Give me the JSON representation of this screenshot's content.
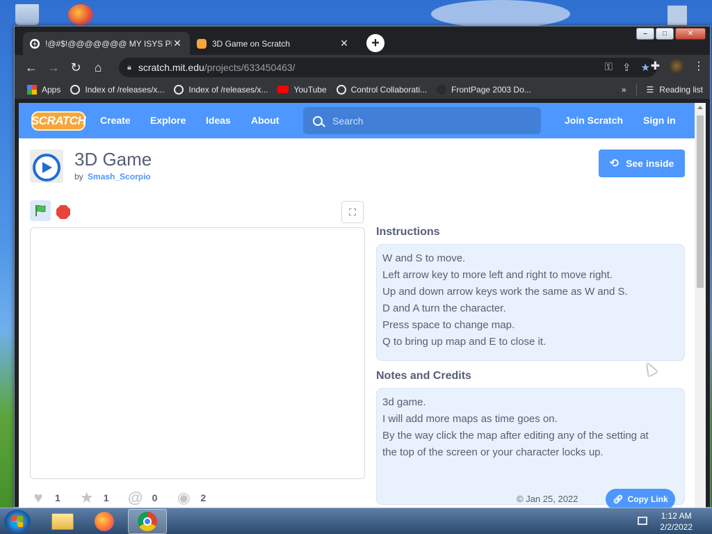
{
  "browser": {
    "tabs": [
      {
        "title": "!@#$!@@@@@@@ MY ISYS PF",
        "active": true
      },
      {
        "title": "3D Game on Scratch",
        "active": false
      }
    ],
    "url_host": "scratch.mit.edu",
    "url_path": "/projects/633450463/",
    "bookmarks": [
      {
        "label": "Apps"
      },
      {
        "label": "Index of /releases/x..."
      },
      {
        "label": "Index of /releases/x..."
      },
      {
        "label": "YouTube"
      },
      {
        "label": "Control Collaborati..."
      },
      {
        "label": "FrontPage 2003 Do..."
      }
    ],
    "more_bookmarks": "»",
    "reading_list": "Reading list"
  },
  "scratch_nav": {
    "logo": "SCRATCH",
    "links": [
      "Create",
      "Explore",
      "Ideas",
      "About"
    ],
    "search_placeholder": "Search",
    "join": "Join Scratch",
    "sign_in": "Sign in"
  },
  "project": {
    "title": "3D Game",
    "by_label": "by",
    "author": "Smash_Scorpio",
    "see_inside": "See inside",
    "instructions_title": "Instructions",
    "instructions": [
      "W and S to move.",
      "Left arrow key to more left and right to move right.",
      "Up and down arrow keys work the same as W and S.",
      "D and A turn the character.",
      "Press space to change map.",
      "Q to bring up map and E to close it."
    ],
    "notes_title": "Notes and Credits",
    "notes": [
      "3d game.",
      "I will add more maps as time goes on.",
      "By the way click the map after editing any of the setting at",
      "the top of the screen or your character locks up."
    ],
    "stats": {
      "loves": "1",
      "favorites": "1",
      "remixes": "0",
      "views": "2"
    },
    "date": "Jan 25, 2022",
    "copy_link": "Copy Link"
  },
  "taskbar": {
    "time": "1:12 AM",
    "date": "2/2/2022"
  },
  "colors": {
    "scratch_blue": "#4d97ff",
    "scratch_text": "#575e75",
    "chrome_dark": "#35363a"
  }
}
